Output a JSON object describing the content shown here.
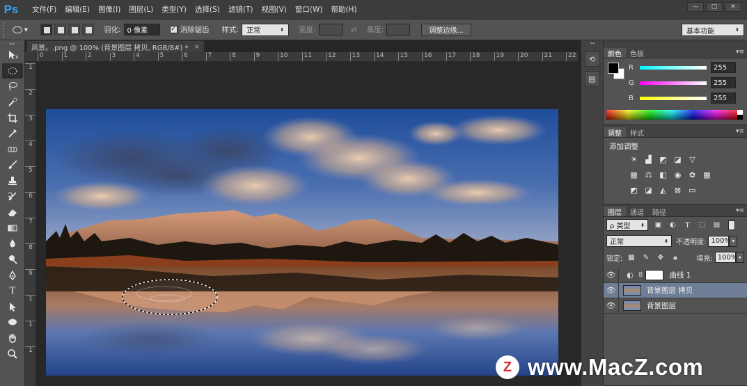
{
  "app": {
    "logo": "Ps",
    "menu": [
      "文件(F)",
      "编辑(E)",
      "图像(I)",
      "图层(L)",
      "类型(Y)",
      "选择(S)",
      "滤镜(T)",
      "视图(V)",
      "窗口(W)",
      "帮助(H)"
    ],
    "window_controls": [
      "—",
      "□",
      "✕"
    ]
  },
  "options": {
    "feather_label": "羽化:",
    "feather_value": "0 像素",
    "antialias_label": "消除锯齿",
    "antialias_checked": true,
    "style_label": "样式:",
    "style_value": "正常",
    "width_label": "宽度:",
    "height_label": "高度:",
    "refine_button": "调整边缘...",
    "workspace": "基本功能"
  },
  "document": {
    "tab_title": "风景。.png @ 100% (背景图层 拷贝, RGB/8#) *",
    "ruler_h": [
      "0",
      "1",
      "2",
      "3",
      "4",
      "5",
      "6",
      "7",
      "8",
      "9",
      "10",
      "11",
      "12",
      "13",
      "14",
      "15",
      "16",
      "17",
      "18",
      "19",
      "20",
      "21",
      "22"
    ],
    "ruler_v": [
      "1",
      "2",
      "3",
      "4",
      "5",
      "6",
      "7",
      "8",
      "9",
      "1",
      "1",
      "1"
    ]
  },
  "toolbar": {
    "tools": [
      "move-tool",
      "elliptical-marquee-tool",
      "lasso-tool",
      "quick-selection-tool",
      "crop-tool",
      "eyedropper-tool",
      "spot-healing-tool",
      "brush-tool",
      "clone-stamp-tool",
      "history-brush-tool",
      "eraser-tool",
      "gradient-tool",
      "blur-tool",
      "dodge-tool",
      "pen-tool",
      "type-tool",
      "path-selection-tool",
      "ellipse-shape-tool",
      "hand-tool",
      "zoom-tool"
    ],
    "active_tool": "elliptical-marquee-tool"
  },
  "color_panel": {
    "tabs": [
      "颜色",
      "色板"
    ],
    "r_label": "R",
    "r_value": "255",
    "g_label": "G",
    "g_value": "255",
    "b_label": "B",
    "b_value": "255"
  },
  "adjust_panel": {
    "tabs": [
      "调整",
      "样式"
    ],
    "title": "添加调整"
  },
  "layers_panel": {
    "tabs": [
      "图层",
      "通道",
      "路径"
    ],
    "filter_label": "ρ 类型",
    "blend_mode": "正常",
    "opacity_label": "不透明度:",
    "opacity_value": "100%",
    "lock_label": "锁定:",
    "fill_label": "填充:",
    "fill_value": "100%",
    "layers": [
      {
        "name": "曲线 1",
        "type": "adjustment",
        "selected": false
      },
      {
        "name": "背景图层 拷贝",
        "type": "image",
        "selected": true
      },
      {
        "name": "背景图层",
        "type": "image",
        "selected": false
      }
    ]
  },
  "watermark": {
    "logo_letter": "Z",
    "text": "www.MacZ.com"
  }
}
